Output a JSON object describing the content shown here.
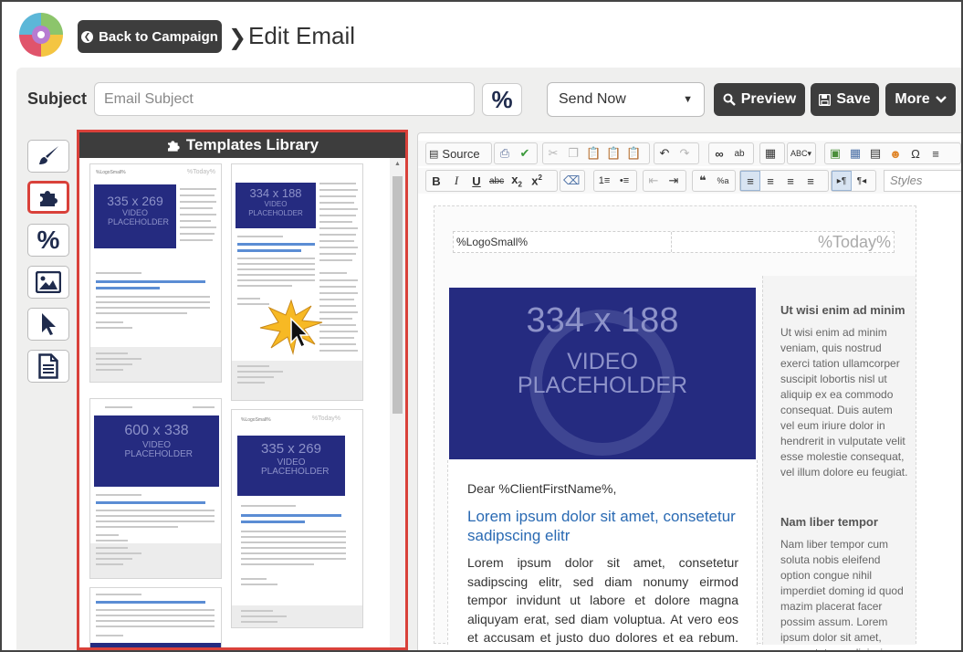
{
  "header": {
    "back_label": "Back to Campaign",
    "title": "Edit Email"
  },
  "subject": {
    "label": "Subject",
    "placeholder": "Email Subject",
    "merge_symbol": "%"
  },
  "actions": {
    "send_option": "Send Now",
    "preview_label": "Preview",
    "save_label": "Save",
    "more_label": "More"
  },
  "tools": [
    "brush-icon",
    "puzzle-icon",
    "percent-icon",
    "image-icon",
    "cursor-icon",
    "document-icon"
  ],
  "templates": {
    "title": "Templates Library",
    "items": [
      {
        "video": "335 x 269",
        "placeholder": "VIDEO PLACEHOLDER"
      },
      {
        "video": "334 x 188",
        "placeholder": "VIDEO PLACEHOLDER"
      },
      {
        "video": "600 x 338",
        "placeholder": "VIDEO PLACEHOLDER"
      },
      {
        "video": "335 x 269",
        "placeholder": "VIDEO PLACEHOLDER"
      }
    ]
  },
  "toolbar": {
    "source_label": "Source",
    "styles_placeholder": "Styles"
  },
  "email": {
    "logo_token": "%LogoSmall%",
    "date_token": "%Today%",
    "video_dim": "334 x 188",
    "video_line1": "VIDEO",
    "video_line2": "PLACEHOLDER",
    "greeting": "Dear %ClientFirstName%,",
    "headline": "Lorem ipsum dolor sit amet, consetetur sadipscing elitr",
    "body": "Lorem ipsum dolor sit amet, consetetur sadipscing elitr, sed diam nonumy eirmod tempor invidunt ut labore et dolore magna aliquyam erat, sed diam voluptua. At vero eos et accusam et justo duo dolores et ea rebum. Stet clita kasd gubergren, no sea takimata",
    "side_heading1": "Ut wisi enim ad minim",
    "side_text1": "Ut wisi enim ad minim veniam, quis nostrud exerci tation ullamcorper suscipit lobortis nisl ut aliquip ex ea commodo consequat. Duis autem vel eum iriure dolor in hendrerit in vulputate velit esse molestie consequat, vel illum dolore eu feugiat.",
    "side_heading2": "Nam liber tempor",
    "side_text2": "Nam liber tempor cum soluta nobis eleifend option congue nihil imperdiet doming id quod mazim placerat facer possim assum. Lorem ipsum dolor sit amet, consectetuer adipiscing"
  },
  "colors": {
    "accent_red": "#d9413a",
    "dark_button": "#3d3d3d",
    "video_blue": "#252b80",
    "headline_blue": "#2a6ab3"
  }
}
